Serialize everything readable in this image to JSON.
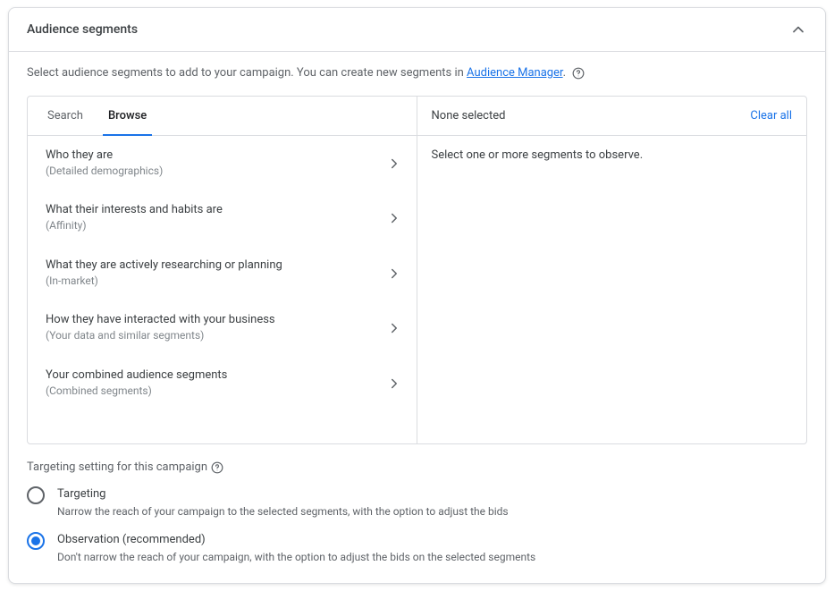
{
  "header": {
    "title": "Audience segments"
  },
  "intro": {
    "prefix": "Select audience segments to add to your campaign. You can create new segments in ",
    "link_text": "Audience Manager",
    "suffix": "."
  },
  "tabs": {
    "search": "Search",
    "browse": "Browse"
  },
  "browse_items": [
    {
      "title": "Who they are",
      "sub": "(Detailed demographics)"
    },
    {
      "title": "What their interests and habits are",
      "sub": "(Affinity)"
    },
    {
      "title": "What they are actively researching or planning",
      "sub": "(In-market)"
    },
    {
      "title": "How they have interacted with your business",
      "sub": "(Your data and similar segments)"
    },
    {
      "title": "Your combined audience segments",
      "sub": "(Combined segments)"
    }
  ],
  "right": {
    "header": "None selected",
    "clear": "Clear all",
    "body": "Select one or more segments to observe."
  },
  "targeting": {
    "heading": "Targeting setting for this campaign",
    "options": [
      {
        "title": "Targeting",
        "desc": "Narrow the reach of your campaign to the selected segments, with the option to adjust the bids"
      },
      {
        "title": "Observation (recommended)",
        "desc": "Don't narrow the reach of your campaign, with the option to adjust the bids on the selected segments"
      }
    ]
  }
}
